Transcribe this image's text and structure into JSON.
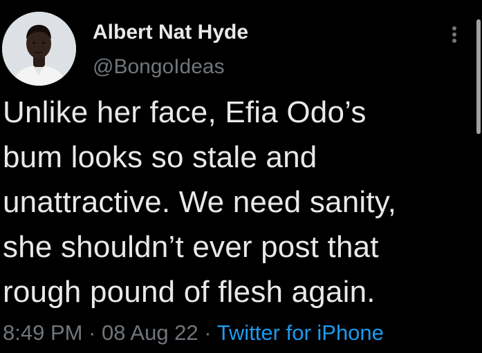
{
  "author": {
    "display_name": "Albert Nat Hyde",
    "handle": "@BongoIdeas"
  },
  "tweet": {
    "text": "Unlike her face, Efia Odo’s\nbum looks so stale and\nunattractive. We need sanity,\nshe shouldn’t ever post that\nrough pound of flesh again.",
    "time": "8:49 PM",
    "separator": "·",
    "date": "08 Aug 22",
    "source": "Twitter for iPhone"
  },
  "icons": {
    "more": "more-vertical-icon",
    "avatar": "avatar"
  },
  "colors": {
    "background": "#000000",
    "text_primary": "#e7e9ea",
    "text_secondary": "#71767b",
    "link": "#1d9bf0"
  }
}
